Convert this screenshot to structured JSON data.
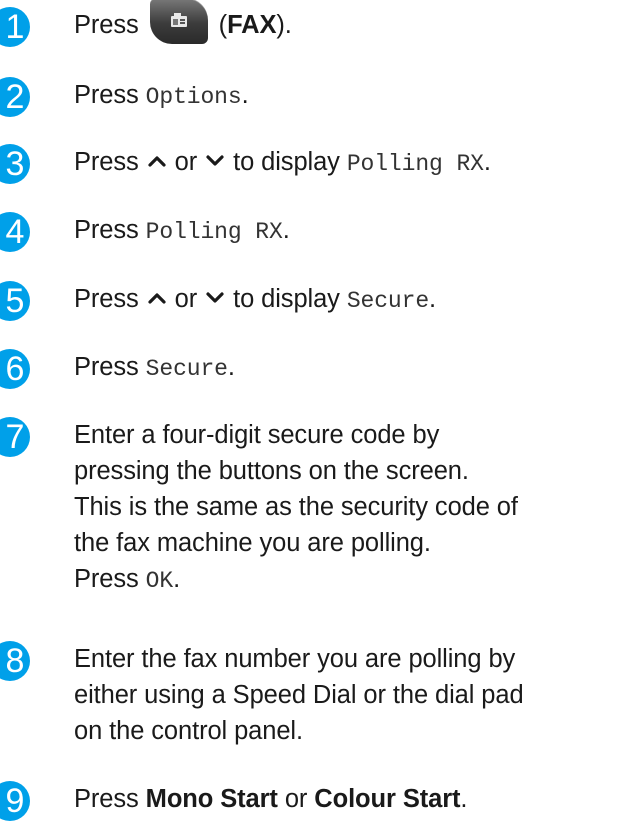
{
  "steps": [
    {
      "num": "1",
      "pre": "Press ",
      "icon": "fax-icon",
      "post_open": " (",
      "bold": "FAX",
      "post": ")."
    },
    {
      "num": "2",
      "pre": "Press ",
      "code": "Options",
      "post": "."
    },
    {
      "num": "3",
      "pre": "Press ",
      "mid1": " or ",
      "mid2": " to display ",
      "code": "Polling RX",
      "post": "."
    },
    {
      "num": "4",
      "pre": "Press ",
      "code": "Polling RX",
      "post": "."
    },
    {
      "num": "5",
      "pre": "Press ",
      "mid1": " or ",
      "mid2": " to display ",
      "code": "Secure",
      "post": "."
    },
    {
      "num": "6",
      "pre": "Press ",
      "code": "Secure",
      "post": "."
    },
    {
      "num": "7",
      "lines": [
        "Enter a four-digit secure code by",
        "pressing the buttons on the screen.",
        "This is the same as the security code of",
        "the fax machine you are polling."
      ],
      "pre2": "Press ",
      "code": "OK",
      "post": "."
    },
    {
      "num": "8",
      "lines": [
        "Enter the fax number you are polling by",
        "either using a Speed Dial or the dial pad",
        "on the control panel."
      ]
    },
    {
      "num": "9",
      "pre": "Press ",
      "bold1": "Mono Start",
      "mid": " or ",
      "bold2": "Colour Start",
      "post": "."
    }
  ],
  "colors": {
    "step_number_bg": "#00a0e9"
  }
}
